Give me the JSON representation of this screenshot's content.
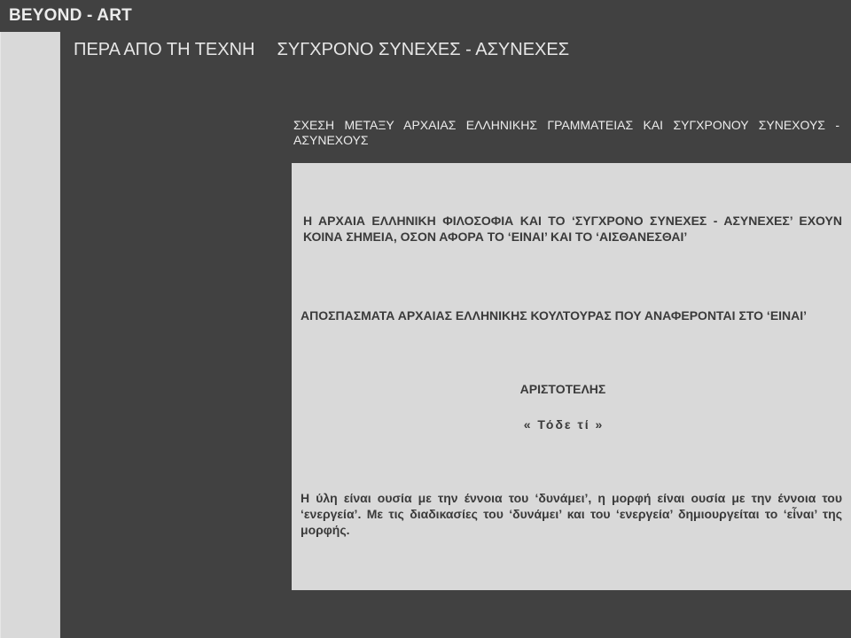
{
  "header": {
    "site_title": "BEYOND - ART"
  },
  "page": {
    "heading_part1": "ΠΕΡΑ ΑΠΟ ΤΗ ΤΕΧΝΗ",
    "heading_part2": "ΣΥΓΧΡΟΝΟ ΣΥΝΕΧΕΣ - ΑΣΥΝΕΧΕΣ",
    "section_heading": "ΣΧΕΣΗ ΜΕΤΑΞΥ ΑΡΧΑΙΑΣ ΕΛΛΗΝΙΚΗΣ ΓΡΑΜΜΑΤΕΙΑΣ ΚΑΙ ΣΥΓΧΡΟΝΟΥ ΣΥΝΕΧΟΥΣ - ΑΣΥΝΕΧΟΥΣ"
  },
  "panel": {
    "intro": "Η ΑΡΧΑΙΑ ΕΛΛΗΝΙΚΗ ΦΙΛΟΣΟΦΙΑ ΚΑΙ ΤΟ ‘ΣΥΓΧΡΟΝΟ ΣΥΝΕΧΕΣ - ΑΣΥΝΕΧΕΣ’ ΕΧΟΥΝ ΚΟΙΝΑ ΣΗΜΕΙΑ, ΟΣΟΝ ΑΦΟΡΑ ΤΟ ‘ΕΙΝΑΙ’ ΚΑΙ ΤΟ ‘ΑΙΣΘΑΝΕΣΘΑΙ’",
    "excerpts_heading": "ΑΠΟΣΠΑΣΜΑΤΑ ΑΡΧΑΙΑΣ ΕΛΛΗΝΙΚΗΣ ΚΟΥΛΤΟΥΡΑΣ ΠΟΥ ΑΝΑΦΕΡΟΝΤΑΙ ΣΤΟ ‘ΕΙΝΑΙ’",
    "author": "ΑΡΙΣΤΟΤΕΛΗΣ",
    "quote": "« Τόδε τί »",
    "body": "Η ύλη είναι ουσία με την έννοια του ‘δυνάμει’, η μορφή είναι ουσία με την έννοια του ‘ενεργεία’. Με τις διαδικασίες του ‘δυνάμει’ και του ‘ενεργεία’ δημιουργείται το ‘εἶναι’ της μορφής."
  }
}
